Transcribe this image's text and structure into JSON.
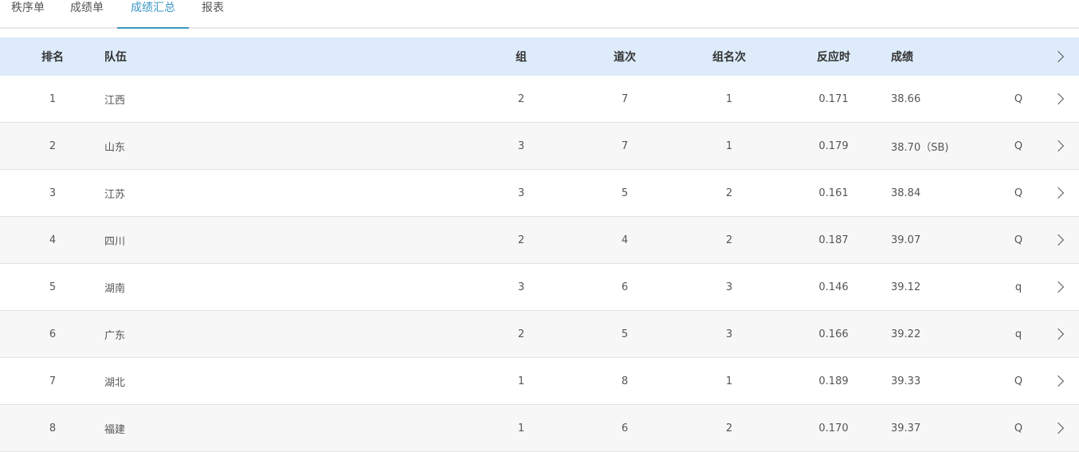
{
  "tabs": [
    {
      "label": "秩序单"
    },
    {
      "label": "成绩单"
    },
    {
      "label": "成绩汇总"
    },
    {
      "label": "报表"
    }
  ],
  "active_tab_index": 2,
  "accent_color": "#3b97c4",
  "header_bg_color": "#ddebfa",
  "table": {
    "headers": {
      "rank": "排名",
      "team": "队伍",
      "group": "组",
      "lane": "道次",
      "group_rank": "组名次",
      "reaction": "反应时",
      "result": "成绩"
    },
    "rows": [
      {
        "rank": "1",
        "team": "江西",
        "group": "2",
        "lane": "7",
        "group_rank": "1",
        "reaction": "0.171",
        "result": "38.66",
        "qualifier": "Q"
      },
      {
        "rank": "2",
        "team": "山东",
        "group": "3",
        "lane": "7",
        "group_rank": "1",
        "reaction": "0.179",
        "result": "38.70（SB)",
        "qualifier": "Q"
      },
      {
        "rank": "3",
        "team": "江苏",
        "group": "3",
        "lane": "5",
        "group_rank": "2",
        "reaction": "0.161",
        "result": "38.84",
        "qualifier": "Q"
      },
      {
        "rank": "4",
        "team": "四川",
        "group": "2",
        "lane": "4",
        "group_rank": "2",
        "reaction": "0.187",
        "result": "39.07",
        "qualifier": "Q"
      },
      {
        "rank": "5",
        "team": "湖南",
        "group": "3",
        "lane": "6",
        "group_rank": "3",
        "reaction": "0.146",
        "result": "39.12",
        "qualifier": "q"
      },
      {
        "rank": "6",
        "team": "广东",
        "group": "2",
        "lane": "5",
        "group_rank": "3",
        "reaction": "0.166",
        "result": "39.22",
        "qualifier": "q"
      },
      {
        "rank": "7",
        "team": "湖北",
        "group": "1",
        "lane": "8",
        "group_rank": "1",
        "reaction": "0.189",
        "result": "39.33",
        "qualifier": "Q"
      },
      {
        "rank": "8",
        "team": "福建",
        "group": "1",
        "lane": "6",
        "group_rank": "2",
        "reaction": "0.170",
        "result": "39.37",
        "qualifier": "Q"
      }
    ]
  }
}
